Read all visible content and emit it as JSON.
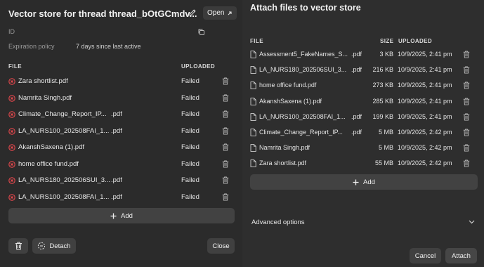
{
  "left": {
    "title": "Vector store for thread thread_bOtGCmdv...",
    "open_label": "Open",
    "id_label": "ID",
    "expiration_label": "Expiration policy",
    "expiration_value": "7 days since last active",
    "col_file": "FILE",
    "col_uploaded": "UPLOADED",
    "files": [
      {
        "name": "Zara shortlist.pdf",
        "ext": "",
        "status": "Failed"
      },
      {
        "name": "Namrita Singh.pdf",
        "ext": "",
        "status": "Failed"
      },
      {
        "name": "Climate_Change_Report_IP...",
        "ext": ".pdf",
        "status": "Failed"
      },
      {
        "name": "LA_NURS100_202508FAI_1...",
        "ext": ".pdf",
        "status": "Failed"
      },
      {
        "name": "AkanshSaxena (1).pdf",
        "ext": "",
        "status": "Failed"
      },
      {
        "name": "home office fund.pdf",
        "ext": "",
        "status": "Failed"
      },
      {
        "name": "LA_NURS180_202506SUI_3...",
        "ext": ".pdf",
        "status": "Failed"
      },
      {
        "name": "LA_NURS100_202508FAI_1...",
        "ext": ".pdf",
        "status": "Failed"
      }
    ],
    "add_label": "Add",
    "detach_label": "Detach",
    "close_label": "Close"
  },
  "right": {
    "title": "Attach files to vector store",
    "col_file": "FILE",
    "col_size": "SIZE",
    "col_uploaded": "UPLOADED",
    "files": [
      {
        "name": "Assessment5_FakeNames_S...",
        "ext": ".pdf",
        "size": "3 KB",
        "date": "10/9/2025, 2:41 pm"
      },
      {
        "name": "LA_NURS180_202506SUI_3...",
        "ext": ".pdf",
        "size": "216 KB",
        "date": "10/9/2025, 2:41 pm"
      },
      {
        "name": "home office fund.pdf",
        "ext": "",
        "size": "273 KB",
        "date": "10/9/2025, 2:41 pm"
      },
      {
        "name": "AkanshSaxena (1).pdf",
        "ext": "",
        "size": "285 KB",
        "date": "10/9/2025, 2:41 pm"
      },
      {
        "name": "LA_NURS100_202508FAI_1...",
        "ext": ".pdf",
        "size": "199 KB",
        "date": "10/9/2025, 2:41 pm"
      },
      {
        "name": "Climate_Change_Report_IP...",
        "ext": ".pdf",
        "size": "5 MB",
        "date": "10/9/2025, 2:42 pm"
      },
      {
        "name": "Namrita Singh.pdf",
        "ext": "",
        "size": "5 MB",
        "date": "10/9/2025, 2:42 pm"
      },
      {
        "name": "Zara shortlist.pdf",
        "ext": "",
        "size": "55 MB",
        "date": "10/9/2025, 2:42 pm"
      }
    ],
    "add_label": "Add",
    "advanced_label": "Advanced options",
    "cancel_label": "Cancel",
    "attach_label": "Attach"
  },
  "colors": {
    "error": "#e5484d",
    "panel_left": "#2b2b2b",
    "panel_right": "#2e2e2e",
    "button": "#404040"
  }
}
